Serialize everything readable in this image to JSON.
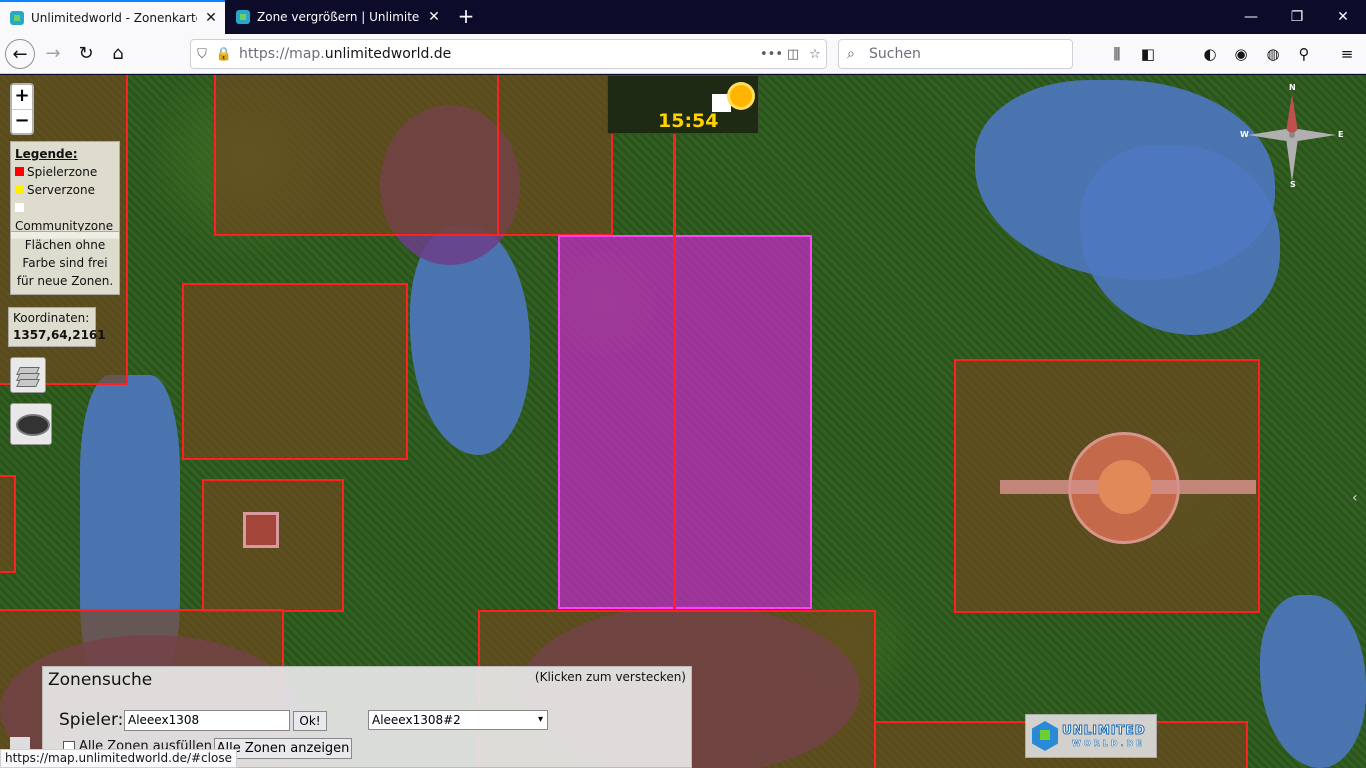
{
  "browser": {
    "tabs": [
      {
        "title": "Unlimitedworld - Zonenkarte",
        "active": true
      },
      {
        "title": "Zone vergrößern | Unlimitedwo",
        "active": false
      }
    ],
    "new_tab": "+",
    "url_host": "https://map.",
    "url_domain": "unlimitedworld.de",
    "search_placeholder": "Suchen",
    "status_url": "https://map.unlimitedworld.de/#close"
  },
  "map": {
    "zoom_in": "+",
    "zoom_out": "−",
    "legend": {
      "title": "Legende:",
      "items": [
        {
          "label": "Spielerzone",
          "color": "#ff0000"
        },
        {
          "label": "Serverzone",
          "color": "#ffee00"
        },
        {
          "label": "Communityzone",
          "color": "#ffffff"
        }
      ]
    },
    "free_info": "Flächen ohne Farbe sind frei für neue Zonen.",
    "coords_label": "Koordinaten:",
    "coords_value": "1357,64,2161",
    "clock_time": "15:54",
    "compass": {
      "n": "N",
      "e": "E",
      "s": "S",
      "w": "W"
    }
  },
  "zone_search": {
    "title": "Zonensuche",
    "hide_hint": "(Klicken zum verstecken)",
    "player_label": "Spieler:",
    "player_value": "Aleeex1308",
    "ok_button": "Ok!",
    "zone_select": "Aleeex1308#2",
    "fill_all_label": "Alle Zonen ausfüllen",
    "show_all_button": "Alle Zonen anzeigen"
  },
  "logo": {
    "line1": "UNLIMITED",
    "line2": "WORLD.DE"
  },
  "colors": {
    "zone_border": "#ff2020",
    "selected_zone": "#ff40ff",
    "accent_tab": "#0a84ff"
  }
}
